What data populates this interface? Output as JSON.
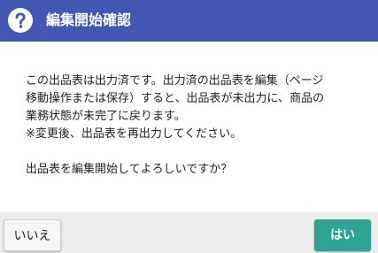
{
  "dialog": {
    "title": "編集開始確認",
    "icon": "help-circle-icon",
    "header_color": "#4257b2",
    "message_lines": [
      "この出品表は出力済です。出力済の出品表を編集（ページ",
      "移動操作または保存）すると、出品表が未出力に、商品の",
      "業務状態が未完了に戻ります。",
      "※変更後、出品表を再出力してください。"
    ],
    "question": "出品表を編集開始してよろしいですか？",
    "buttons": {
      "no_label": "いいえ",
      "yes_label": "はい",
      "yes_color": "#2fa394"
    }
  }
}
